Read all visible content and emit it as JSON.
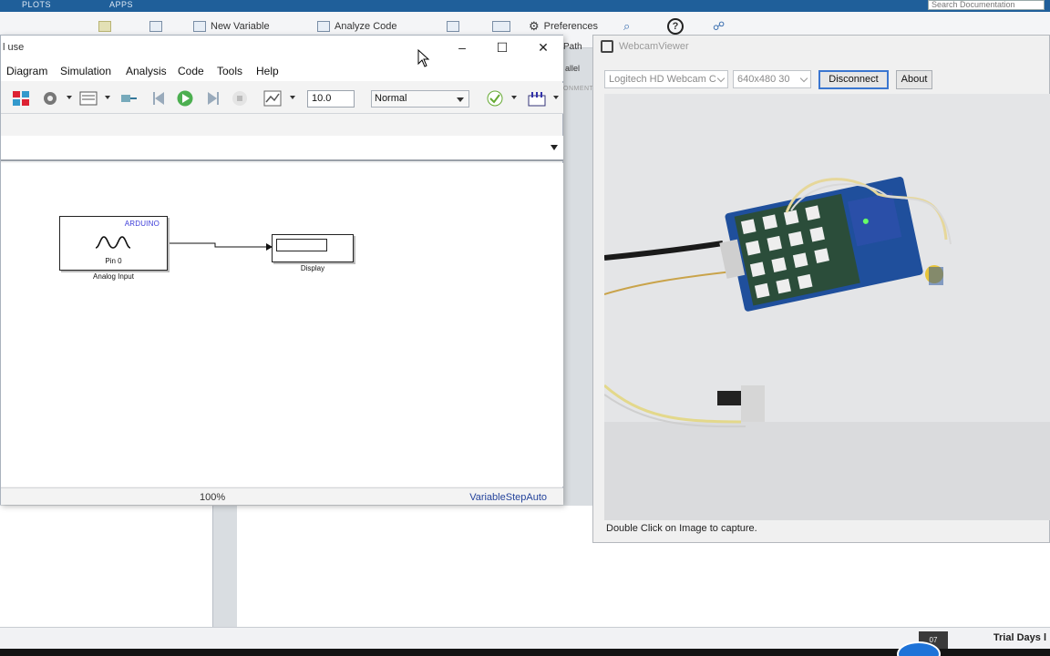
{
  "matlab": {
    "tabs": [
      "PLOTS",
      "APPS"
    ],
    "ribbon": {
      "new_variable": "New Variable",
      "analyze_code": "Analyze Code",
      "preferences": "Preferences",
      "search_placeholder": "Search Documentation",
      "path_label": "Path",
      "parallel_label": "allel",
      "environment_label": "ONMENT"
    },
    "status": {
      "trial": "Trial Days l",
      "clock": "07"
    }
  },
  "simulink": {
    "title": "l use",
    "menu": [
      "Diagram",
      "Simulation",
      "Analysis",
      "Code",
      "Tools",
      "Help"
    ],
    "toolbar": {
      "stop_time": "10.0",
      "sim_mode": "Normal"
    },
    "blocks": {
      "analog_input": {
        "badge": "ARDUINO",
        "pin": "Pin 0",
        "name": "Analog Input"
      },
      "display": {
        "name": "Display"
      }
    },
    "statusbar": {
      "zoom": "100%",
      "solver": "VariableStepAuto"
    }
  },
  "webcam": {
    "title": "WebcamViewer",
    "camera": "Logitech HD Webcam C",
    "resolution": "640x480 30",
    "disconnect": "Disconnect",
    "about": "About",
    "hint": "Double Click on Image to capture."
  }
}
